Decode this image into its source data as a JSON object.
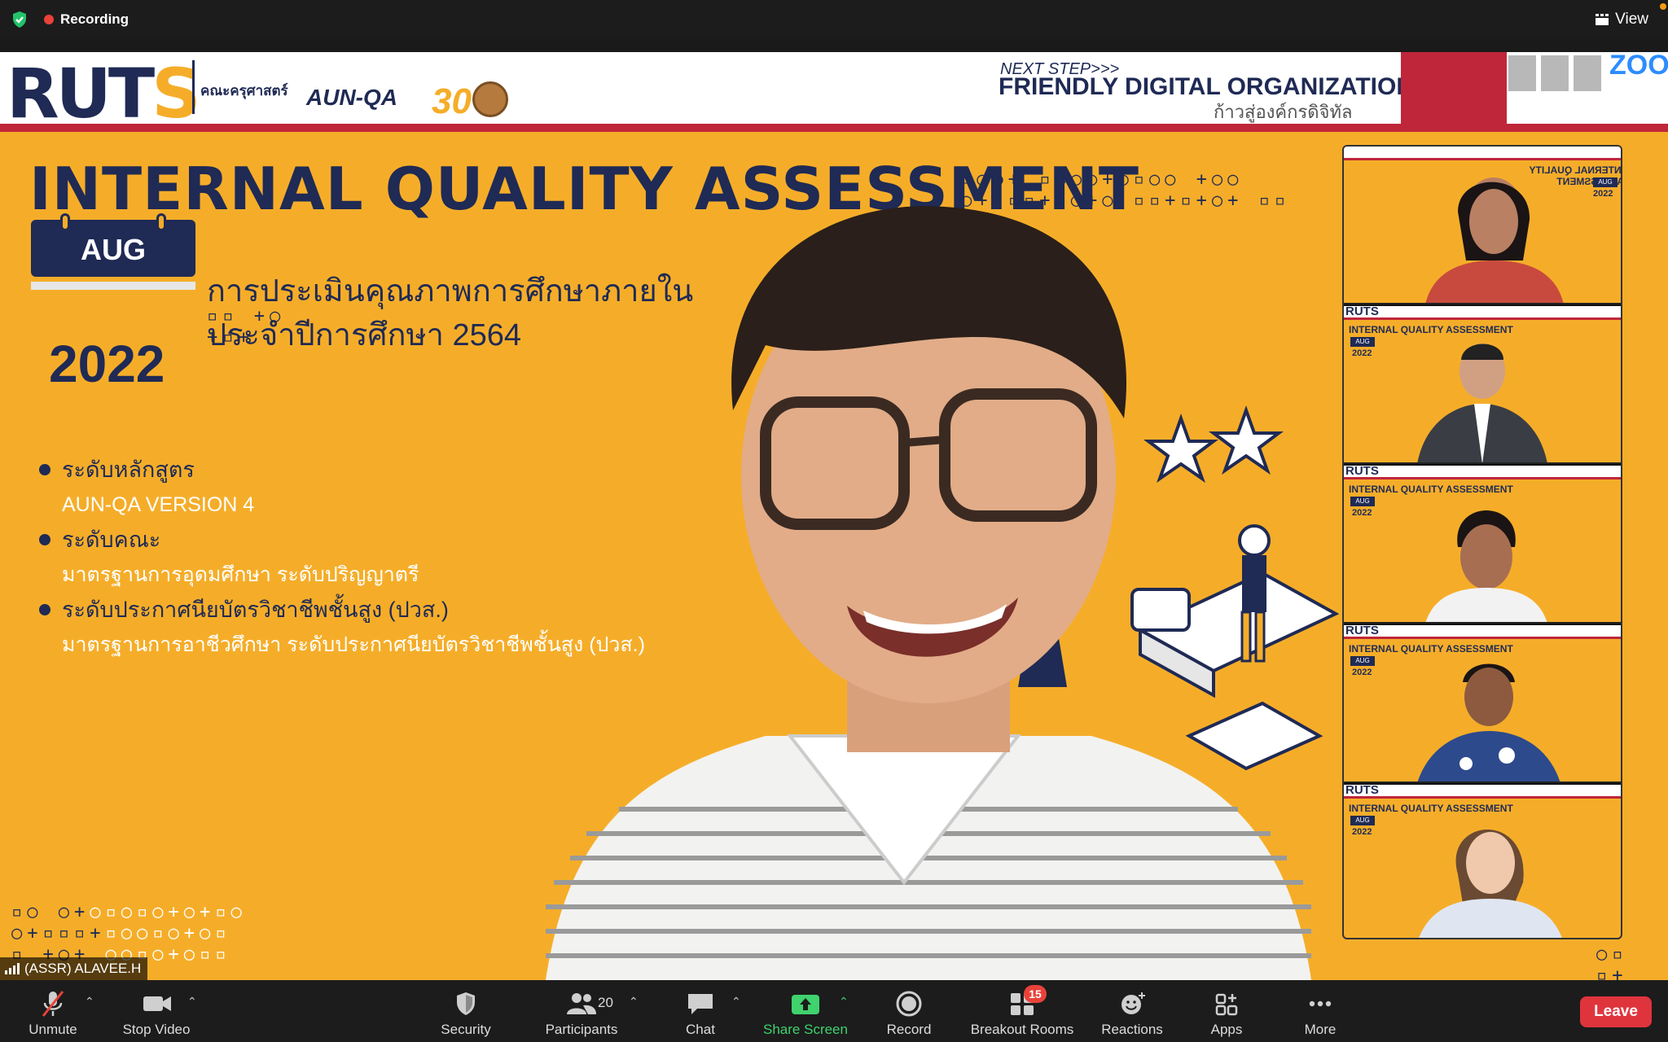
{
  "topbar": {
    "recording_label": "Recording",
    "view_label": "View"
  },
  "slide": {
    "logo_text": "RUTS",
    "faculty": "คณะครุศาสตร์",
    "aunqa": "AUN-QA",
    "next_step": "NEXT STEP>>>",
    "friendly": "FRIENDLY DIGITAL ORGANIZATION",
    "friendly_sub": "ก้าวสู่องค์กรดิจิทัล",
    "zoom_brand": "ZOOM",
    "title": "INTERNAL QUALITY ASSESSMENT",
    "month": "AUG",
    "year": "2022",
    "thai_line1": "การประเมินคุณภาพการศึกษาภายใน",
    "thai_line2": "ประจำปีการศึกษา 2564",
    "bullets": [
      {
        "label": "ระดับหลักสูตร",
        "sub": "AUN-QA VERSION 4"
      },
      {
        "label": "ระดับคณะ",
        "sub": "มาตรฐานการอุดมศึกษา ระดับปริญญาตรี"
      },
      {
        "label": "ระดับประกาศนียบัตรวิชาชีพชั้นสูง (ปวส.)",
        "sub": "มาตรฐานการอาชีวศึกษา ระดับประกาศนียบัตรวิชาชีพชั้นสูง (ปวส.)"
      }
    ]
  },
  "thumbnails": [
    {
      "title": "INTERNAL QUALITY ASSESSMENT",
      "month": "AUG",
      "year": "2022",
      "mirrored": true
    },
    {
      "title": "INTERNAL QUALITY ASSESSMENT",
      "month": "AUG",
      "year": "2022"
    },
    {
      "title": "INTERNAL QUALITY ASSESSMENT",
      "month": "AUG",
      "year": "2022"
    },
    {
      "title": "INTERNAL QUALITY ASSESSMENT",
      "month": "AUG",
      "year": "2022"
    },
    {
      "title": "INTERNAL QUALITY ASSESSMENT",
      "month": "AUG",
      "year": "2022"
    }
  ],
  "speaker": {
    "name": "(ASSR) ALAVEE.H"
  },
  "toolbar": {
    "unmute": "Unmute",
    "stop_video": "Stop Video",
    "security": "Security",
    "participants": "Participants",
    "participants_count": "20",
    "chat": "Chat",
    "share_screen": "Share Screen",
    "record": "Record",
    "breakout_rooms": "Breakout Rooms",
    "breakout_badge": "15",
    "reactions": "Reactions",
    "apps": "Apps",
    "more": "More",
    "leave": "Leave"
  },
  "colors": {
    "slide_bg": "#f5ad29",
    "navy": "#1f2a55",
    "accent_red": "#c0263a",
    "share_green": "#3fd26d",
    "leave_red": "#e0343d"
  }
}
